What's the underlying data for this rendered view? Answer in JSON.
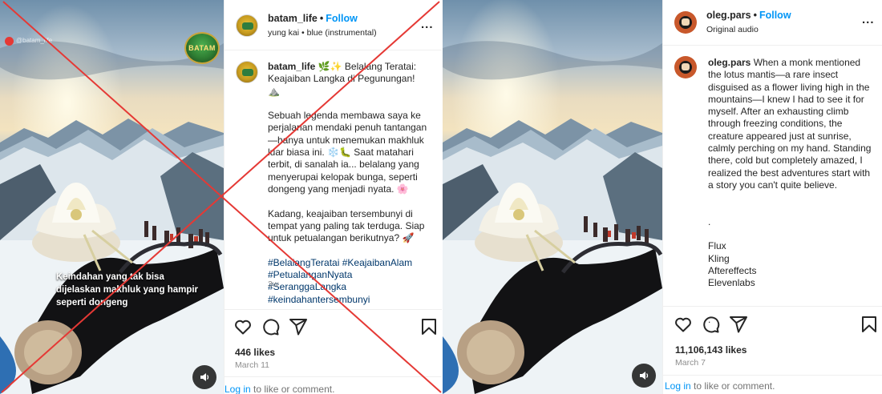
{
  "left_post": {
    "overlay_caption": "Keindahan yang tak bisa dijelaskan makhluk yang hampir seperti dongeng",
    "badge_text": "BATAM",
    "username": "batam_life",
    "separator": "•",
    "follow_label": "Follow",
    "audio": "yung kai • blue (instrumental)",
    "more_label": "...",
    "comment_user": "batam_life",
    "comment_text": " 🌿✨ Belalang Teratai: Keajaiban Langka di Pegunungan! ⛰️\n\nSebuah legenda membawa saya ke perjalanan mendaki penuh tantangan—hanya untuk menemukan makhluk luar biasa ini. ❄️🐛 Saat matahari terbit, di sanalah ia... belalang yang menyerupai kelopak bunga, seperti dongeng yang menjadi nyata. 🌸\n\nKadang, keajaiban tersembunyi di tempat yang paling tak terduga. Siap untuk petualangan berikutnya? 🚀\n\n",
    "hashtags": "#BelalangTeratai #KeajaibanAlam #PetualanganNyata #SeranggaLangka #keindahantersembunyi",
    "time_ago": "3w",
    "likes": "446 likes",
    "date": "March 11",
    "login_link": "Log in",
    "login_rest": " to like or comment."
  },
  "right_post": {
    "username": "oleg.pars",
    "separator": "•",
    "follow_label": "Follow",
    "audio": "Original audio",
    "more_label": "...",
    "comment_user": "oleg.pars",
    "comment_text": " When a monk mentioned the lotus mantis—a rare insect disguised as a flower living high in the mountains—I knew I had to see it for myself. After an exhausting climb through freezing conditions, the creature appeared just at sunrise, calmly perching on my hand. Standing there, cold but completely amazed, I realized the best adventures start with a story you can't quite believe.\n\n\n.\n\nFlux\nKling\nAftereffects\nElevenlabs\n\n\n.",
    "likes": "11,106,143 likes",
    "date": "March 7",
    "login_link": "Log in",
    "login_rest": " to like or comment."
  },
  "icons": [
    "heart-icon",
    "comment-icon",
    "share-icon",
    "bookmark-icon",
    "sound-icon"
  ],
  "colors": {
    "follow": "#0095f6",
    "hashtag": "#00376b",
    "x_mark": "#e53935",
    "muted": "#8e8e8e"
  }
}
